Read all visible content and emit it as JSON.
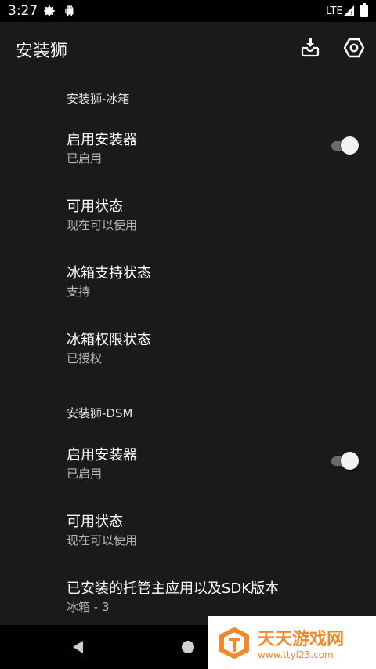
{
  "status_bar": {
    "time": "3:27",
    "network": "LTE",
    "icons": [
      "gear-icon",
      "android-icon",
      "signal-icon",
      "battery-icon"
    ]
  },
  "app_bar": {
    "title": "安装狮",
    "actions": [
      "install-inbox-icon",
      "settings-hexagon-icon"
    ]
  },
  "sections": [
    {
      "title": "安装狮-冰箱",
      "items": [
        {
          "title": "启用安装器",
          "summary": "已启用",
          "switch": true
        },
        {
          "title": "可用状态",
          "summary": "现在可以使用"
        },
        {
          "title": "冰箱支持状态",
          "summary": "支持"
        },
        {
          "title": "冰箱权限状态",
          "summary": "已授权"
        }
      ]
    },
    {
      "title": "安装狮-DSM",
      "items": [
        {
          "title": "启用安装器",
          "summary": "已启用",
          "switch": true
        },
        {
          "title": "可用状态",
          "summary": "现在可以使用"
        },
        {
          "title": "已安装的托管主应用以及SDK版本",
          "summary": "冰箱 - 3"
        }
      ]
    }
  ],
  "nav_bar": {
    "buttons": [
      "back-icon",
      "home-icon"
    ]
  },
  "watermark": {
    "name": "天天游戏网",
    "url": "www.ttyl23.com"
  },
  "colors": {
    "background": "#1a1a1a",
    "status_bar": "#000000",
    "watermark_accent": "#f08a2a",
    "switch_thumb": "#f2f2f2",
    "switch_track": "#6b6b6b"
  }
}
